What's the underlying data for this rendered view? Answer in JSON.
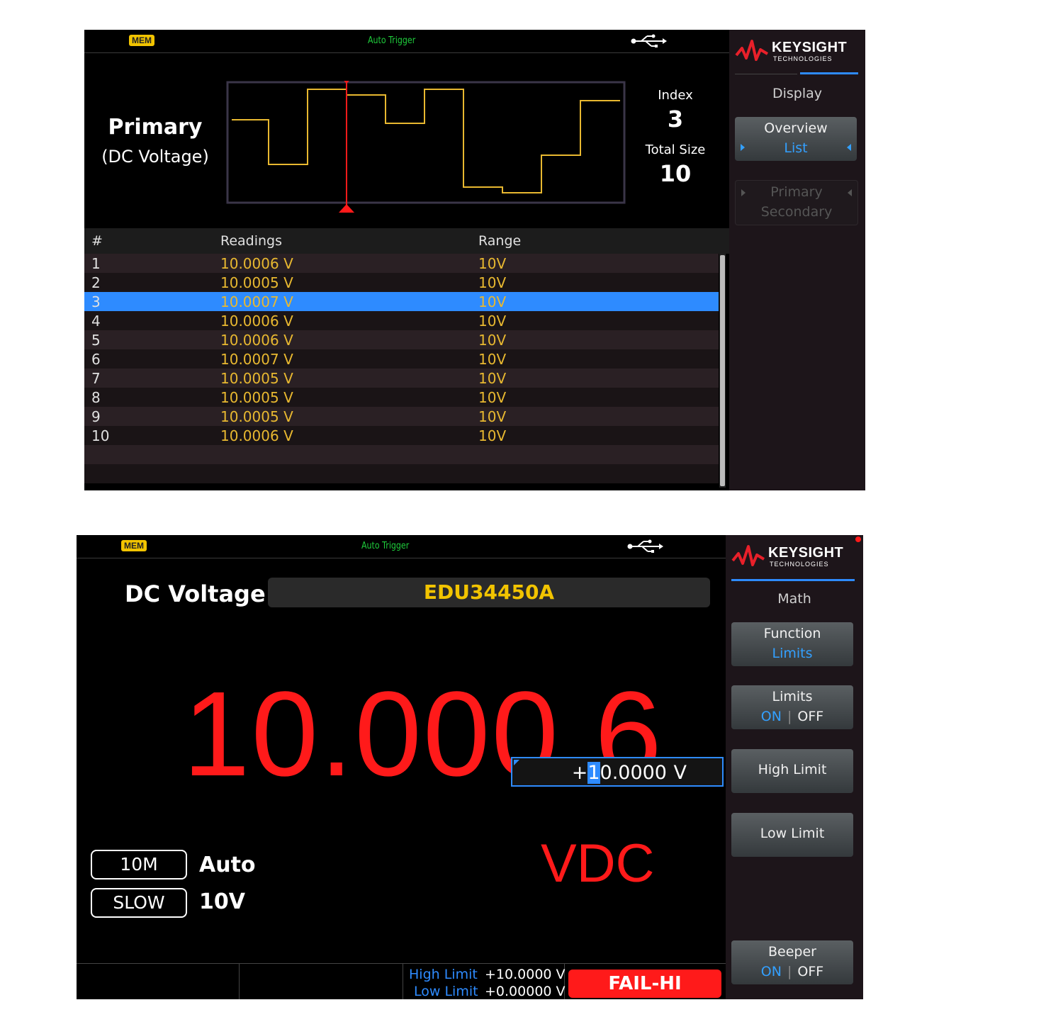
{
  "screen1": {
    "status": {
      "mem": "MEM",
      "trigger": "Auto Trigger",
      "usb_icon": "usb-icon"
    },
    "brand": {
      "name": "KEYSIGHT",
      "sub": "TECHNOLOGIES"
    },
    "menu_title": "Display",
    "softkeys": [
      {
        "line1": "Overview",
        "line2": "List"
      },
      {
        "line1": "Primary",
        "line2": "Secondary"
      }
    ],
    "measurement": {
      "title": "Primary",
      "subtitle": "(DC Voltage)"
    },
    "index": {
      "label": "Index",
      "value": "3"
    },
    "total": {
      "label": "Total Size",
      "value": "10"
    },
    "table": {
      "headers": [
        "#",
        "Readings",
        "Range"
      ],
      "rows": [
        {
          "num": "1",
          "reading": "10.0006  V",
          "range": "10V"
        },
        {
          "num": "2",
          "reading": "10.0005  V",
          "range": "10V"
        },
        {
          "num": "3",
          "reading": "10.0007  V",
          "range": "10V"
        },
        {
          "num": "4",
          "reading": "10.0006  V",
          "range": "10V"
        },
        {
          "num": "5",
          "reading": "10.0006  V",
          "range": "10V"
        },
        {
          "num": "6",
          "reading": "10.0007  V",
          "range": "10V"
        },
        {
          "num": "7",
          "reading": "10.0005  V",
          "range": "10V"
        },
        {
          "num": "8",
          "reading": "10.0005  V",
          "range": "10V"
        },
        {
          "num": "9",
          "reading": "10.0005  V",
          "range": "10V"
        },
        {
          "num": "10",
          "reading": "10.0006  V",
          "range": "10V"
        }
      ],
      "selected_row": 3
    },
    "colors": {
      "accent": "#2e8bff",
      "trace": "#e8b830",
      "marker": "#ff1a1a"
    }
  },
  "screen2": {
    "status": {
      "mem": "MEM",
      "trigger": "Auto Trigger",
      "usb_icon": "usb-icon"
    },
    "brand": {
      "name": "KEYSIGHT",
      "sub": "TECHNOLOGIES"
    },
    "menu_title": "Math",
    "softkeys": {
      "function": {
        "line1": "Function",
        "line2": "Limits"
      },
      "limits": {
        "line1": "Limits",
        "on": "ON",
        "sep": "|",
        "off": "OFF"
      },
      "high_limit": {
        "line1": "High Limit"
      },
      "low_limit": {
        "line1": "Low Limit"
      },
      "beeper": {
        "line1": "Beeper",
        "on": "ON",
        "sep": "|",
        "off": "OFF"
      }
    },
    "function_label": "DC Voltage",
    "model": "EDU34450A",
    "reading": "10.000 6",
    "unit": "VDC",
    "entry": {
      "prefix": "+",
      "cursor_digit": "1",
      "rest": "0.0000",
      "unit": "V"
    },
    "impedance": "10M",
    "range_mode": "Auto",
    "speed": "SLOW",
    "range": "10V",
    "limits": {
      "high_label": "High Limit",
      "high_value": "+10.0000  V",
      "low_label": "Low Limit",
      "low_value": "+0.00000  V"
    },
    "status_badge": "FAIL-HI",
    "colors": {
      "reading": "#ff1a1a",
      "model": "#f2c400",
      "accent": "#2e8bff"
    }
  }
}
